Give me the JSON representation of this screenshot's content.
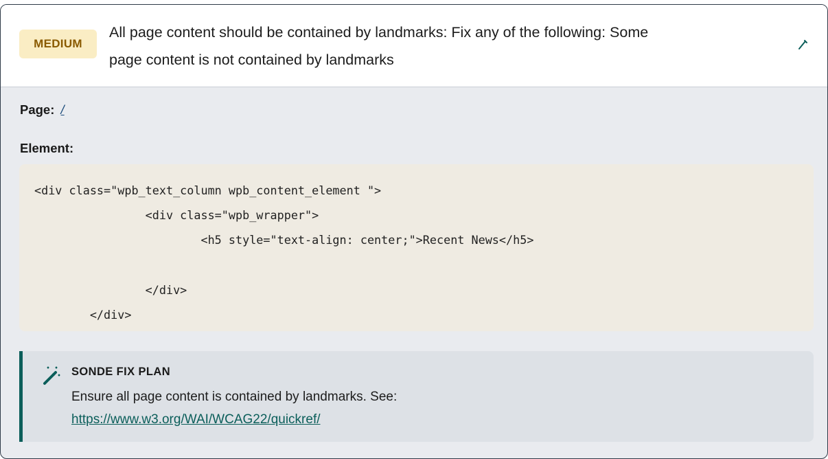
{
  "issue": {
    "severity": "MEDIUM",
    "title_line1": "All page content should be contained by landmarks: Fix any of the following: Some",
    "title_line2": "page content is not contained by landmarks",
    "edit_icon": "pencil-icon"
  },
  "details": {
    "page_label": "Page:",
    "page_value": "/",
    "element_label": "Element:",
    "code": "<div class=\"wpb_text_column wpb_content_element \">\n                <div class=\"wpb_wrapper\">\n                        <h5 style=\"text-align: center;\">Recent News</h5>\n\n                </div>\n        </div>"
  },
  "fix_plan": {
    "icon": "magic-wand-icon",
    "title": "SONDE FIX PLAN",
    "text": "Ensure all page content is contained by landmarks. See:",
    "link": "https://www.w3.org/WAI/WCAG22/quickref/"
  },
  "colors": {
    "badge_bg": "#faedc4",
    "badge_text": "#8a5a00",
    "accent": "#0b5e5a",
    "code_bg": "#efebe2"
  }
}
